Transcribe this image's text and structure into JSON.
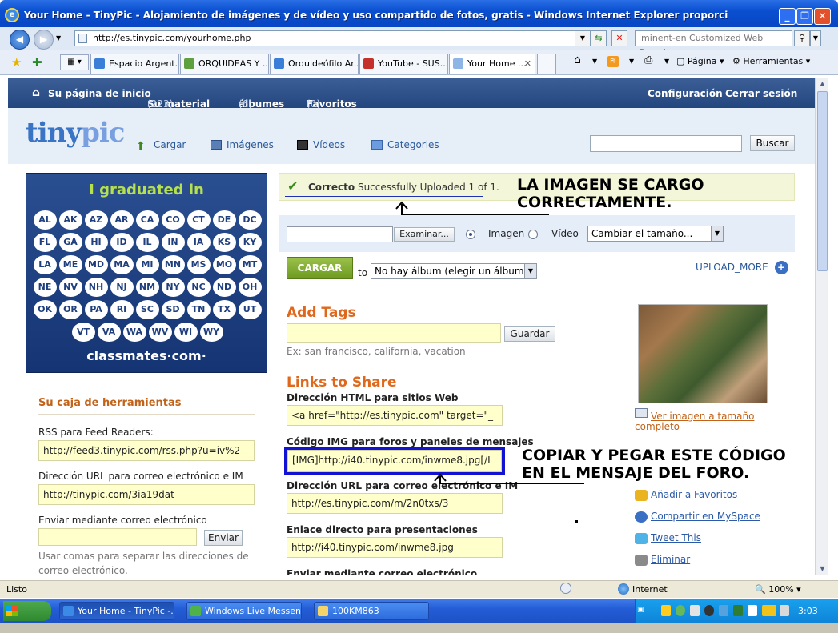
{
  "window": {
    "title": "Your Home - TinyPic - Alojamiento de imágenes y de vídeo y uso compartido de fotos, gratis - Windows Internet Explorer proporci",
    "app_icon": "ie-icon"
  },
  "browser": {
    "url": "http://es.tinypic.com/yourhome.php",
    "search_placeholder": "iminent-en Customized Web Search",
    "tabs": [
      {
        "label": "Espacio Argent..."
      },
      {
        "label": "ORQUIDEAS Y ..."
      },
      {
        "label": "Orquideófilo Ar..."
      },
      {
        "label": "YouTube - SUS..."
      },
      {
        "label": "Your Home ..."
      }
    ],
    "toolbar": {
      "page": "Página",
      "tools": "Herramientas"
    }
  },
  "nav": {
    "home": "Su página de inicio",
    "material": "Su material",
    "material_count": "(223)",
    "albums": "álbumes",
    "albums_count": "(6)",
    "favorites": "Favoritos",
    "favorites_count": "(0)",
    "config": "Configuración",
    "logout": "Cerrar sesión"
  },
  "header": {
    "logo_a": "tiny",
    "logo_b": "pic",
    "links": [
      "Cargar",
      "Imágenes",
      "Vídeos",
      "Categories"
    ],
    "search_button": "Buscar"
  },
  "ad": {
    "headline": "I graduated in",
    "states": [
      "AL",
      "AK",
      "AZ",
      "AR",
      "CA",
      "CO",
      "CT",
      "DE",
      "DC",
      "FL",
      "GA",
      "HI",
      "ID",
      "IL",
      "IN",
      "IA",
      "KS",
      "KY",
      "LA",
      "ME",
      "MD",
      "MA",
      "MI",
      "MN",
      "MS",
      "MO",
      "MT",
      "NE",
      "NV",
      "NH",
      "NJ",
      "NM",
      "NY",
      "NC",
      "ND",
      "OH",
      "OK",
      "OR",
      "PA",
      "RI",
      "SC",
      "SD",
      "TN",
      "TX",
      "UT",
      "VT",
      "VA",
      "WA",
      "WV",
      "WI",
      "WY"
    ],
    "footer": "classmates·com·"
  },
  "toolbox": {
    "title": "Su caja de herramientas",
    "rss_label": "RSS para Feed Readers:",
    "rss_value": "http://feed3.tinypic.com/rss.php?u=iv%2",
    "url_label": "Dirección URL para correo electrónico e IM",
    "url_value": "http://tinypic.com/3ia19dat",
    "email_label": "Enviar mediante correo electrónico",
    "email_button": "Enviar",
    "email_help": "Usar comas para separar las direcciones de correo electrónico."
  },
  "upload": {
    "status_bold": "Correcto",
    "status_text": "Successfully Uploaded 1 of 1.",
    "browse_button": "Examinar...",
    "radio_image": "Imagen",
    "radio_video": "Vídeo",
    "resize_select": "Cambiar el tamaño...",
    "cargar_button": "CARGAR",
    "to_label": "to",
    "album_select": "No hay álbum (elegir un álbum...)",
    "upload_more": "UPLOAD_MORE"
  },
  "tags": {
    "title": "Add Tags",
    "save_button": "Guardar",
    "example": "Ex: san francisco, california, vacation"
  },
  "links": {
    "title": "Links to Share",
    "html_label": "Dirección HTML para sitios Web",
    "html_value": "<a href=\"http://es.tinypic.com\" target=\"_",
    "img_label": "Código IMG para foros y paneles de mensajes",
    "img_value": "[IMG]http://i40.tinypic.com/inwme8.jpg[/I",
    "url_label": "Dirección URL para correo electrónico e IM",
    "url_value": "http://es.tinypic.com/m/2n0txs/3",
    "direct_label": "Enlace directo para presentaciones",
    "direct_value": "http://i40.tinypic.com/inwme8.jpg",
    "email_label": "Enviar mediante correo electrónico"
  },
  "actions": {
    "full_size": "Ver imagen a tamaño completo",
    "favorites": "Añadir a Favoritos",
    "myspace": "Compartir en MySpace",
    "twitter": "Tweet This",
    "delete": "Eliminar"
  },
  "annotations": {
    "note1_line1": "LA IMAGEN SE CARGO",
    "note1_line2": "CORRECTAMENTE.",
    "note2_line1": "COPIAR Y PEGAR ESTE CÓDIGO",
    "note2_line2": "EN EL MENSAJE DEL FORO."
  },
  "status": {
    "left": "Listo",
    "zone": "Internet",
    "zoom": "100%"
  },
  "taskbar": {
    "start": "",
    "tasks": [
      "Your Home - TinyPic -...",
      "Windows Live Messen...",
      "100KM863"
    ],
    "time": "3:03"
  },
  "colors": {
    "accent_blue": "#24467f",
    "tinypic_orange": "#e0681c",
    "field_yellow": "#ffffcc"
  }
}
